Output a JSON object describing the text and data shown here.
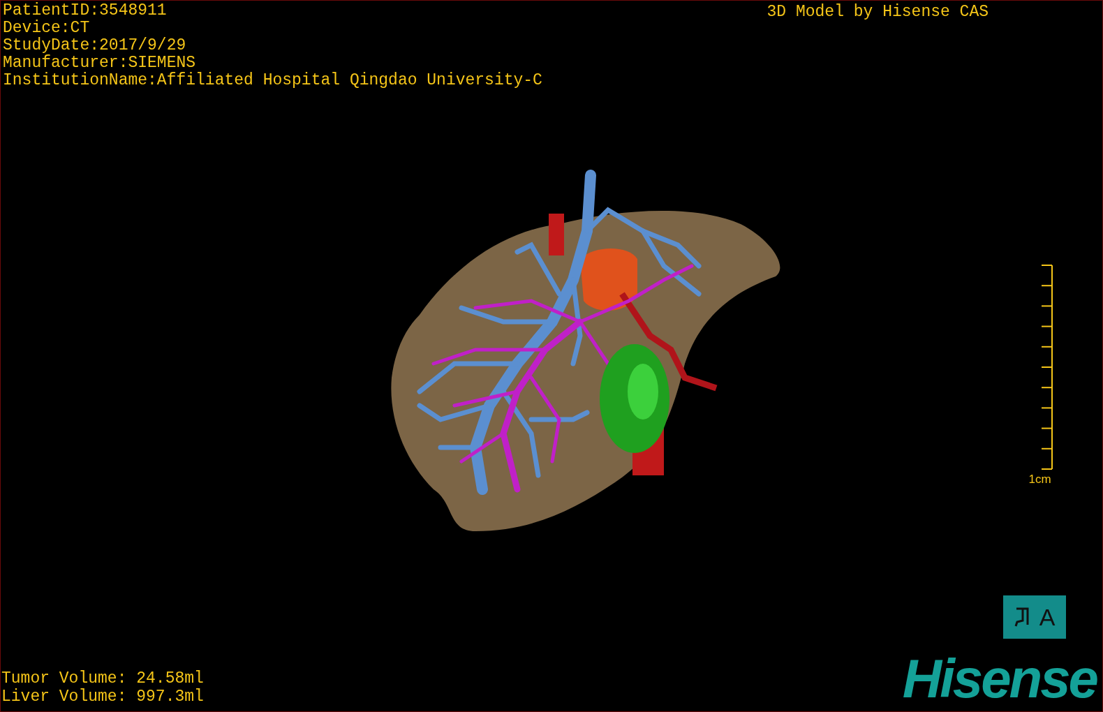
{
  "study_info": [
    "PatientID:3548911",
    "Device:CT",
    "StudyDate:2017/9/29",
    "Manufacturer:SIEMENS",
    "InstitutionName:Affiliated Hospital Qingdao University-C"
  ],
  "model_credit": "3D Model by Hisense CAS",
  "scale_bar": {
    "label": "1cm"
  },
  "orientation_marker": {
    "label": "A"
  },
  "volumes": [
    "Tumor Volume: 24.58ml",
    "Liver Volume: 997.3ml"
  ],
  "logo": "Hisense"
}
